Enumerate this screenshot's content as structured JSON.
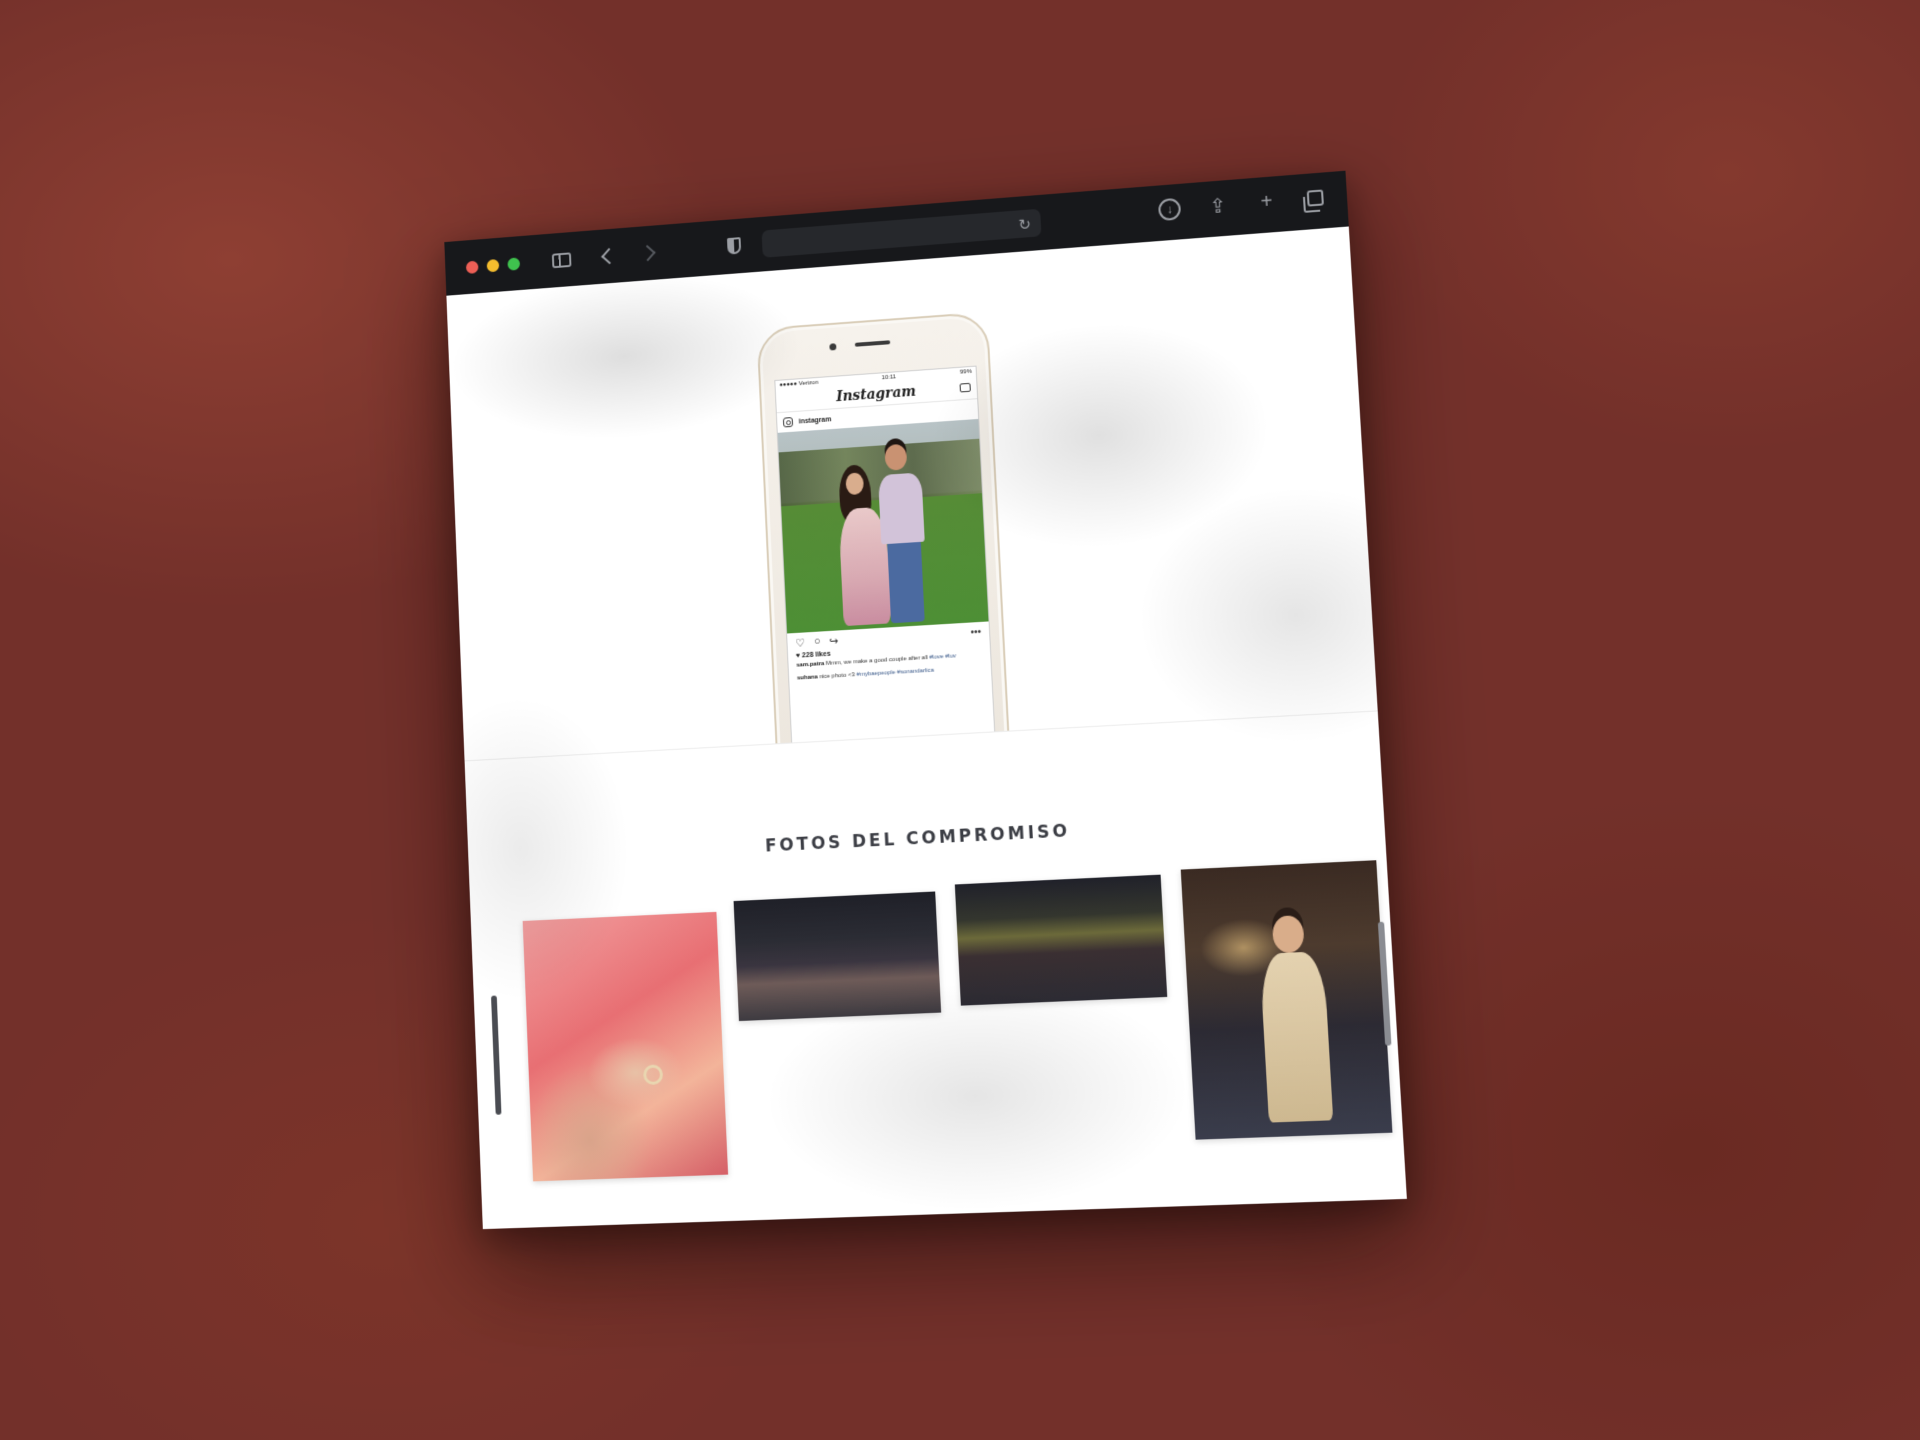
{
  "browser": {
    "traffic_lights": {
      "close": "#ed5f56",
      "minimize": "#f4bc2e",
      "maximize": "#3fc24e"
    },
    "address": "",
    "icons": [
      "sidebar-icon",
      "back-icon",
      "forward-icon",
      "shield-icon",
      "reload-icon",
      "download-icon",
      "share-icon",
      "new-tab-icon",
      "tabs-overview-icon"
    ]
  },
  "phone": {
    "carrier": "●●●●● Verizon",
    "time": "10:11",
    "battery": "99%",
    "app_logo": "Instagram",
    "post_user": "instagram",
    "likes": "♥ 228 likes",
    "captions": [
      {
        "user": "sam.patra",
        "text": "Mmm, we make a good couple after all",
        "tags": "#love #luv"
      },
      {
        "user": "suhana",
        "text": "nice photo <3",
        "tags": "#mybaepeople #sonandarlica"
      }
    ]
  },
  "gallery": {
    "title": "FOTOS DEL COMPROMISO",
    "photos": [
      {
        "name": "gallery-photo-ring",
        "alt": ""
      },
      {
        "name": "gallery-photo-group-dance",
        "alt": ""
      },
      {
        "name": "gallery-photo-friends",
        "alt": ""
      },
      {
        "name": "gallery-photo-groom",
        "alt": ""
      }
    ]
  },
  "colors": {
    "background": "#73302a",
    "toolbar": "#17181b",
    "page": "#ffffff",
    "title_text": "#3c3e45"
  }
}
